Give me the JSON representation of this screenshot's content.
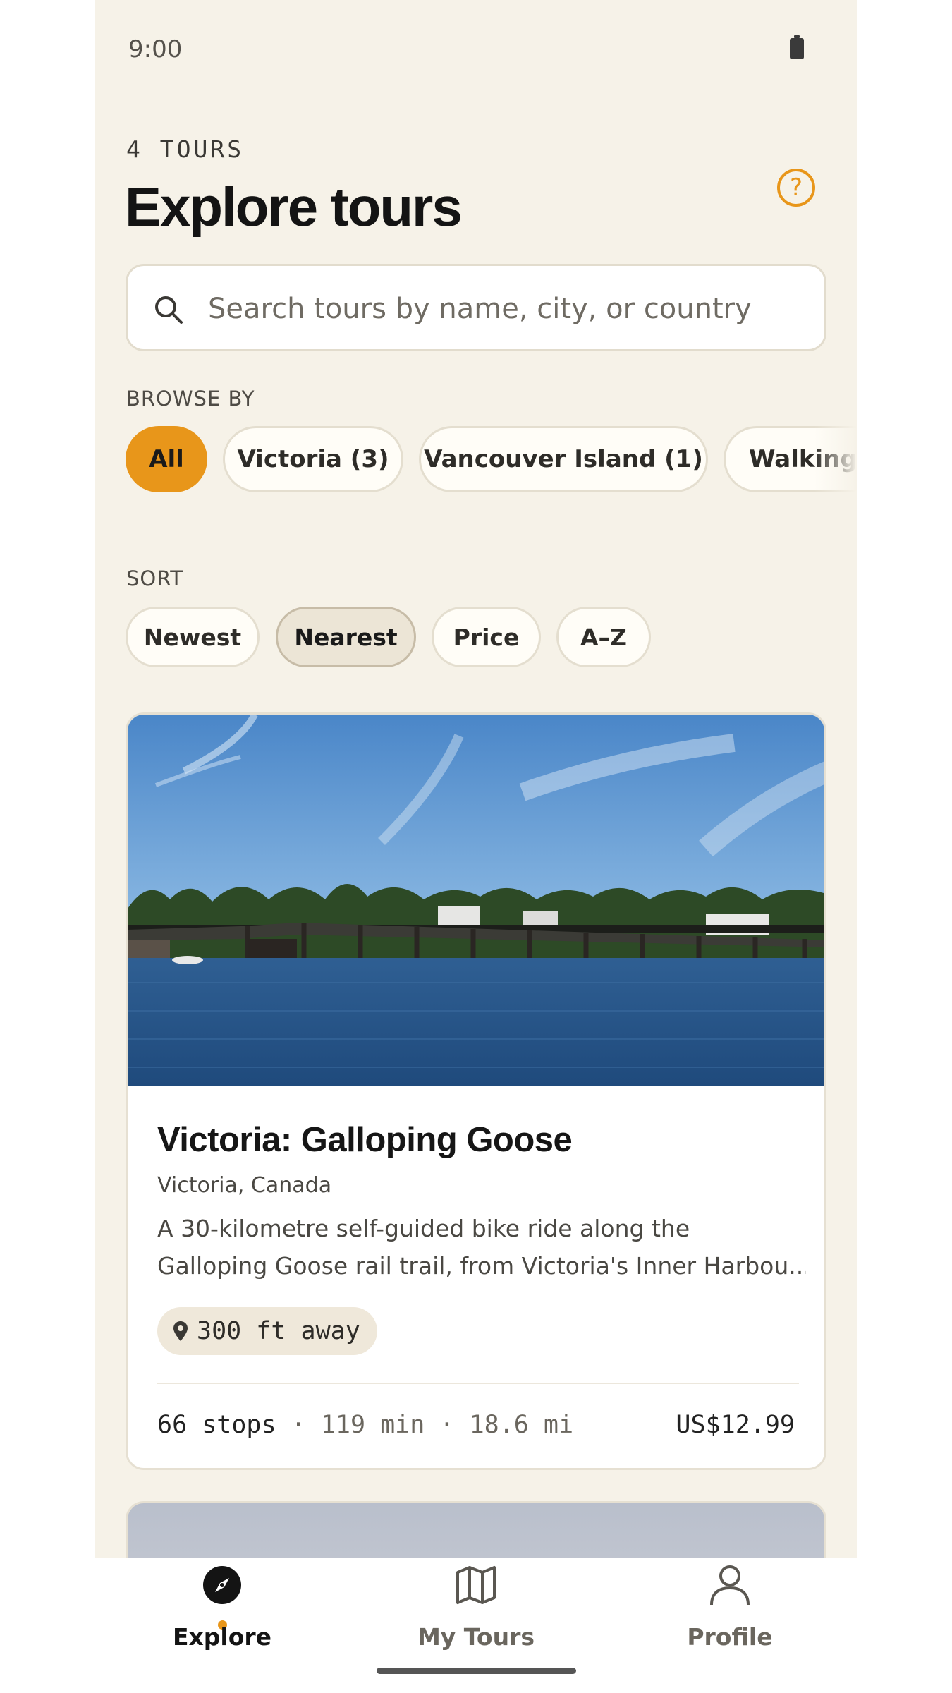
{
  "status_bar": {
    "time": "9:00"
  },
  "header": {
    "count_label": "4 TOURS",
    "title": "Explore tours",
    "help_icon": "question-circle-icon",
    "help_glyph": "?"
  },
  "search": {
    "placeholder": "Search tours by name, city, or country",
    "value": ""
  },
  "browse": {
    "label": "BROWSE BY",
    "chips": [
      {
        "label": "All",
        "active": true
      },
      {
        "label": "Victoria (3)",
        "active": false
      },
      {
        "label": "Vancouver Island (1)",
        "active": false
      },
      {
        "label": "Walking (",
        "active": false
      }
    ]
  },
  "sort": {
    "label": "SORT",
    "options": [
      {
        "label": "Newest",
        "active": false
      },
      {
        "label": "Nearest",
        "active": true
      },
      {
        "label": "Price",
        "active": false
      },
      {
        "label": "A–Z",
        "active": false
      }
    ]
  },
  "tours": [
    {
      "title": "Victoria: Galloping Goose",
      "location": "Victoria, Canada",
      "description_line1": "A 30-kilometre self-guided bike ride along the",
      "description_line2": "Galloping Goose rail trail, from Victoria's Inner Harbou...",
      "distance": "300 ft away",
      "stops": "66 stops",
      "separator": "·",
      "duration": "119 min",
      "length": "18.6 mi",
      "price": "US$12.99"
    }
  ],
  "tab_bar": {
    "tabs": [
      {
        "label": "Explore",
        "icon": "compass-icon",
        "active": true
      },
      {
        "label": "My Tours",
        "icon": "map-icon",
        "active": false
      },
      {
        "label": "Profile",
        "icon": "person-icon",
        "active": false
      }
    ]
  },
  "colors": {
    "accent": "#e8961a",
    "background": "#f6f2e8",
    "text": "#141414"
  }
}
